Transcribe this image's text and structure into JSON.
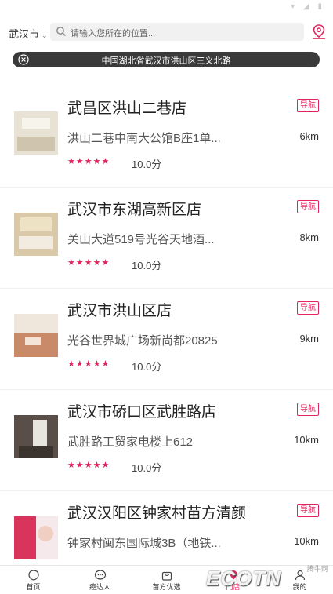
{
  "header": {
    "city": "武汉市",
    "search_placeholder": "请输入您所在的位置..."
  },
  "address_bar": {
    "text": "中国湖北省武汉市洪山区三义北路"
  },
  "stores": [
    {
      "name": "武昌区洪山二巷店",
      "nav_label": "导航",
      "address": "洪山二巷中南大公馆B座1单...",
      "distance": "6km",
      "stars": "★★★★★",
      "score": "10.0分",
      "thumb_color": "#e8e2d4"
    },
    {
      "name": "武汉市东湖高新区店",
      "nav_label": "导航",
      "address": "关山大道519号光谷天地酒...",
      "distance": "8km",
      "stars": "★★★★★",
      "score": "10.0分",
      "thumb_color": "#d9c9a8"
    },
    {
      "name": "武汉市洪山区店",
      "nav_label": "导航",
      "address": "光谷世界城广场新尚都20825",
      "distance": "9km",
      "stars": "★★★★★",
      "score": "10.0分",
      "thumb_color": "#c98a6a"
    },
    {
      "name": "武汉市硚口区武胜路店",
      "nav_label": "导航",
      "address": "武胜路工贸家电楼上612",
      "distance": "10km",
      "stars": "★★★★★",
      "score": "10.0分",
      "thumb_color": "#5a4f48"
    },
    {
      "name": "武汉汉阳区钟家村苗方清颜",
      "nav_label": "导航",
      "address": "钟家村闽东国际城3B（地铁...",
      "distance": "10km",
      "stars": "",
      "score": "",
      "thumb_color": "#d9345c"
    }
  ],
  "tabbar": {
    "tabs": [
      {
        "label": "首页",
        "icon": "home-icon"
      },
      {
        "label": "癌达人",
        "icon": "chat-icon"
      },
      {
        "label": "苗方优选",
        "icon": "bag-icon"
      },
      {
        "label": "门店",
        "icon": "store-icon"
      },
      {
        "label": "我的",
        "icon": "user-icon"
      }
    ]
  },
  "watermark": {
    "text": "ECOTN",
    "small": "腾牛网"
  },
  "colors": {
    "accent": "#e0245e",
    "address_bar_bg": "#3a3a3a"
  }
}
